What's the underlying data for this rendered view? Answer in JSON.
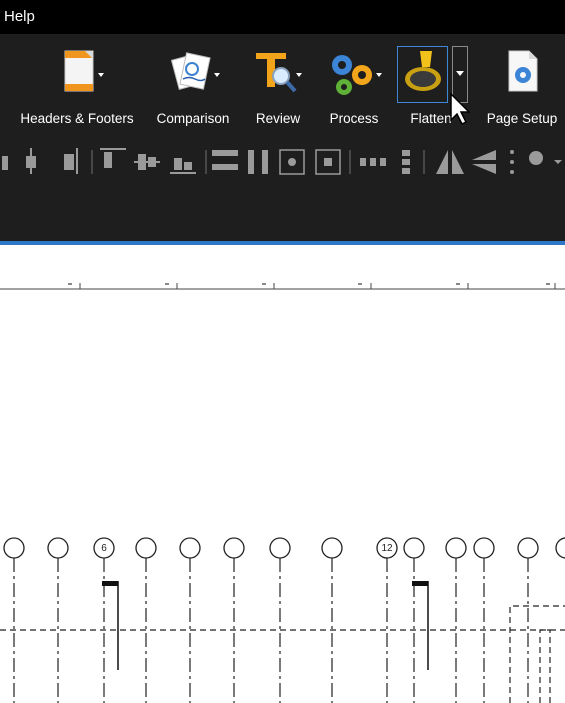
{
  "menubar": {
    "help_label": "Help"
  },
  "ribbon": {
    "tools": [
      {
        "label": "Headers & Footers",
        "icon": "headers-footers-icon"
      },
      {
        "label": "Comparison",
        "icon": "comparison-icon"
      },
      {
        "label": "Review",
        "icon": "review-icon"
      },
      {
        "label": "Process",
        "icon": "process-icon"
      },
      {
        "label": "Flatten",
        "icon": "flatten-icon"
      },
      {
        "label": "Page Setup",
        "icon": "page-setup-icon"
      }
    ],
    "small_tools": [
      "align-left-icon",
      "align-center-icon",
      "align-right-icon",
      "align-top-icon",
      "align-middle-icon",
      "align-bottom-icon",
      "distribute-horizontal-icon",
      "distribute-vertical-icon",
      "center-horizontal-icon",
      "center-page-icon",
      "size-horizontal-icon",
      "size-vertical-icon",
      "flip-horizontal-icon",
      "flip-vertical-icon",
      "more-options-icon",
      "rotate-icon"
    ]
  },
  "drawing": {
    "gridline_labels": [
      "6",
      "12"
    ]
  },
  "colors": {
    "menubar_bg": "#000000",
    "ribbon_bg": "#1e1e1e",
    "accent_blue": "#2f77c9",
    "selected_border": "#3c87d6"
  }
}
